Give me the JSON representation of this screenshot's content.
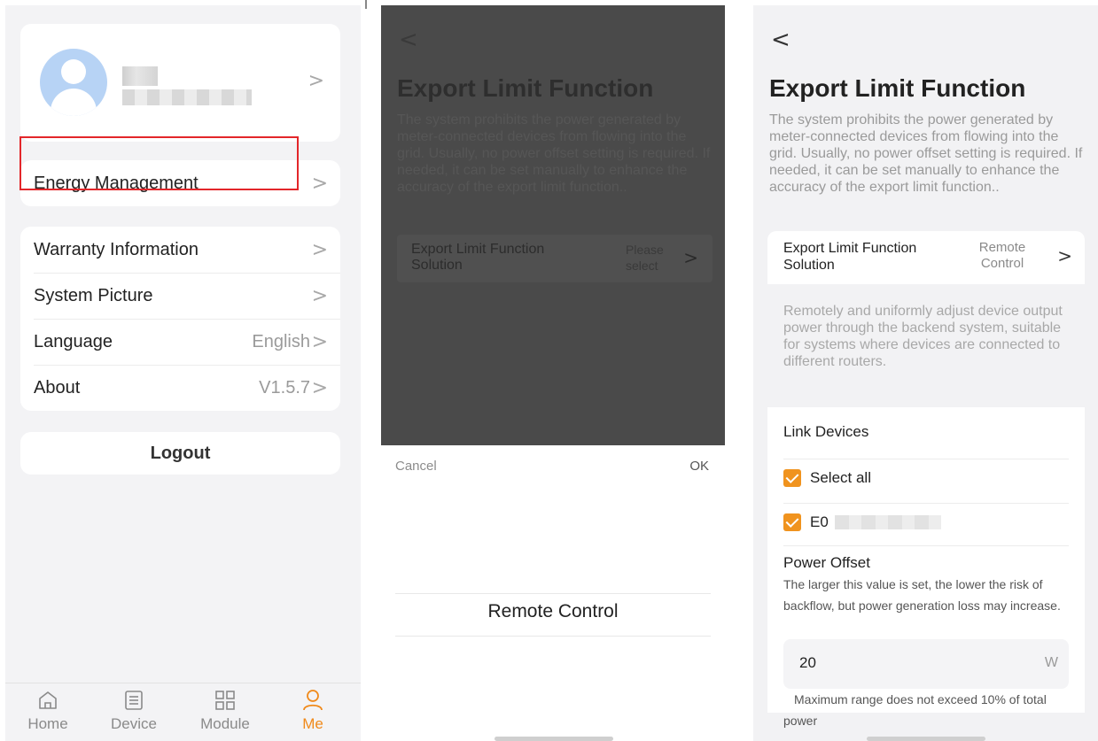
{
  "screen1": {
    "profile_chevron": ">",
    "menu_primary": [
      {
        "label": "Energy Management",
        "value": "",
        "chevron": ">"
      }
    ],
    "menu_secondary": [
      {
        "label": "Warranty Information",
        "value": "",
        "chevron": ">"
      },
      {
        "label": "System Picture",
        "value": "",
        "chevron": ">"
      },
      {
        "label": "Language",
        "value": "English",
        "chevron": ">"
      },
      {
        "label": "About",
        "value": "V1.5.7",
        "chevron": ">"
      }
    ],
    "logout_label": "Logout",
    "tabs": [
      {
        "label": "Home",
        "icon": "home-icon",
        "active": false
      },
      {
        "label": "Device",
        "icon": "device-list-icon",
        "active": false
      },
      {
        "label": "Module",
        "icon": "module-grid-icon",
        "active": false
      },
      {
        "label": "Me",
        "icon": "person-icon",
        "active": true
      }
    ],
    "colors": {
      "active_tab": "#f08a1b",
      "highlight": "#e3262a"
    }
  },
  "screen2": {
    "back": "<",
    "title": "Export Limit Function",
    "description": "The system prohibits the power generated by meter-connected devices from flowing into the grid. Usually, no power offset setting is required. If needed, it can be set manually to enhance the accuracy of the export limit function..",
    "solution_label": "Export Limit Function Solution",
    "solution_placeholder": "Please select",
    "chevron": ">",
    "picker": {
      "cancel": "Cancel",
      "ok": "OK",
      "selected_option": "Remote Control"
    }
  },
  "screen3": {
    "back": "<",
    "title": "Export Limit Function",
    "description": "The system prohibits the power generated by meter-connected devices from flowing into the grid. Usually, no power offset setting is required. If needed, it can be set manually to enhance the accuracy of the export limit function..",
    "solution_label": "Export Limit Function Solution",
    "solution_value": "Remote Control",
    "chevron": ">",
    "solution_info": "Remotely and uniformly adjust device output power through the backend system, suitable for systems where devices are connected to different routers.",
    "link_devices": {
      "heading": "Link Devices",
      "select_all": "Select all",
      "device_prefix": "E0"
    },
    "power_offset": {
      "heading": "Power Offset",
      "description": "The larger this value is set, the lower the risk of backflow, but power generation loss may increase.",
      "value": "20",
      "unit": "W",
      "range_note": "Maximum range does not exceed 10% of total power"
    },
    "colors": {
      "checkbox": "#f0931e"
    }
  }
}
